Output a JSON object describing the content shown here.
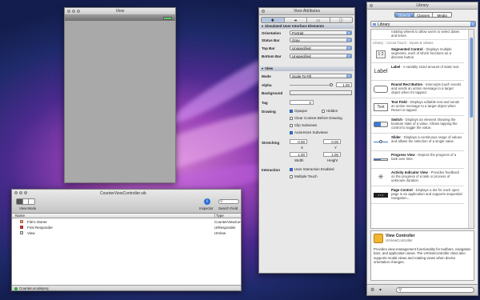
{
  "view_window": {
    "title": "View"
  },
  "xib_window": {
    "title": "CounterViewController.xib",
    "view_mode_label": "View Mode",
    "inspector_label": "Inspector",
    "search_label": "Search Field",
    "columns": [
      "Name",
      "Type"
    ],
    "rows": [
      {
        "name": "File's Owner",
        "type": "CounterViewContr..."
      },
      {
        "name": "First Responder",
        "type": "UIResponder"
      },
      {
        "name": "View",
        "type": "UIView"
      }
    ],
    "status": "Counter.xcodeproj"
  },
  "attributes": {
    "title": "View Attributes",
    "sim_section": "Simulated User Interface Elements",
    "orientation": {
      "label": "Orientation",
      "value": "Portrait"
    },
    "status_bar": {
      "label": "Status Bar",
      "value": "Gray"
    },
    "top_bar": {
      "label": "Top Bar",
      "value": "Unspecified"
    },
    "bottom_bar": {
      "label": "Bottom Bar",
      "value": "Unspecified"
    },
    "view_section": "View",
    "mode": {
      "label": "Mode",
      "value": "Scale To Fill"
    },
    "alpha": {
      "label": "Alpha",
      "value": "1.00"
    },
    "background": {
      "label": "Background"
    },
    "tag": {
      "label": "Tag",
      "value": "0"
    },
    "drawing": {
      "label": "Drawing",
      "opaque": "Opaque",
      "hidden": "Hidden",
      "clear_context": "Clear Context Before Drawing",
      "clip": "Clip Subviews",
      "autoresize": "Autoresize Subviews"
    },
    "stretching": {
      "label": "Stretching",
      "x": "0.00",
      "y": "0.00",
      "width": "1.00",
      "height": "1.00",
      "x_label": "X",
      "y_label": "Y",
      "width_label": "Width",
      "height_label": "Height"
    },
    "interaction": {
      "label": "Interaction",
      "user": "User Interaction Enabled",
      "multi": "Multiple Touch"
    }
  },
  "library": {
    "title": "Library",
    "tabs": [
      "Objects",
      "Classes",
      "Media"
    ],
    "dropdown": "Library",
    "breadcrumb": "Library - Cocoa Touch - Inputs & Values",
    "top_text": "rotating wheels to allow users to select dates and times.",
    "items": [
      {
        "icon": "1 2",
        "name": "Segmented Control",
        "desc": " - Displays multiple segments, each of which functions as a discrete button."
      },
      {
        "icon": "Label",
        "name": "Label",
        "desc": " - A variably sized amount of static text."
      },
      {
        "icon": "",
        "name": "Round Rect Button",
        "desc": " - Intercepts touch events and sends an action message to a target object when it's tapped."
      },
      {
        "icon": "Text",
        "name": "Text Field",
        "desc": " - Displays editable text and sends an action message to a target object when Return is tapped."
      },
      {
        "icon": "",
        "name": "Switch",
        "desc": " - Displays an element showing the boolean state of a value. Allows tapping the control to toggle the value."
      },
      {
        "icon": "",
        "name": "Slider",
        "desc": " - Displays a continuous range of values and allows the selection of a single value."
      },
      {
        "icon": "",
        "name": "Progress View",
        "desc": " - Depicts the progress of a task over time."
      },
      {
        "icon": "",
        "name": "Activity Indicator View",
        "desc": " - Provides feedback on the progress of a task or process of unknown duration."
      },
      {
        "icon": "",
        "name": "Page Control",
        "desc": " - Displays a dot for each open page in an application and supports sequential navigation..."
      }
    ],
    "detail": {
      "name": "View Controller",
      "class": "UIViewController",
      "desc": "Provides view-management functionality for toolbars, navigation bars, and application views. The UIViewController class also supports modal views and rotating views when device orientation changes."
    }
  }
}
